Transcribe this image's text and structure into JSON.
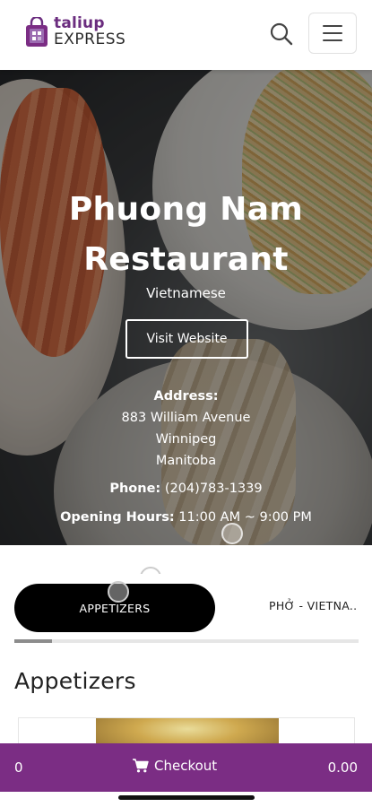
{
  "header": {
    "logo_top": "taliup",
    "logo_bottom": "EXPRESS",
    "search_icon": "search-icon",
    "menu_icon": "hamburger-menu-icon"
  },
  "restaurant": {
    "name_line1": "Phuong Nam",
    "name_line2": "Restaurant",
    "cuisine": "Vietnamese",
    "visit_label": "Visit Website",
    "address_label": "Address:",
    "address_street": "883 William Avenue",
    "address_city": "Winnipeg",
    "address_province": "Manitoba",
    "phone_label": "Phone:",
    "phone_value": "(204)783-1339",
    "hours_label": "Opening Hours:",
    "hours_value": "11:00 AM ~ 9:00 PM"
  },
  "tabs": [
    {
      "label": "APPETIZERS",
      "active": true
    },
    {
      "label": "PHỞ - VIETNA..",
      "active": false
    }
  ],
  "section_title": "Appetizers",
  "checkout": {
    "count": "0",
    "label": "Checkout",
    "total": "0.00",
    "icon": "cart-icon"
  },
  "colors": {
    "brand_purple": "#7b2d84",
    "tab_active": "#000000"
  }
}
